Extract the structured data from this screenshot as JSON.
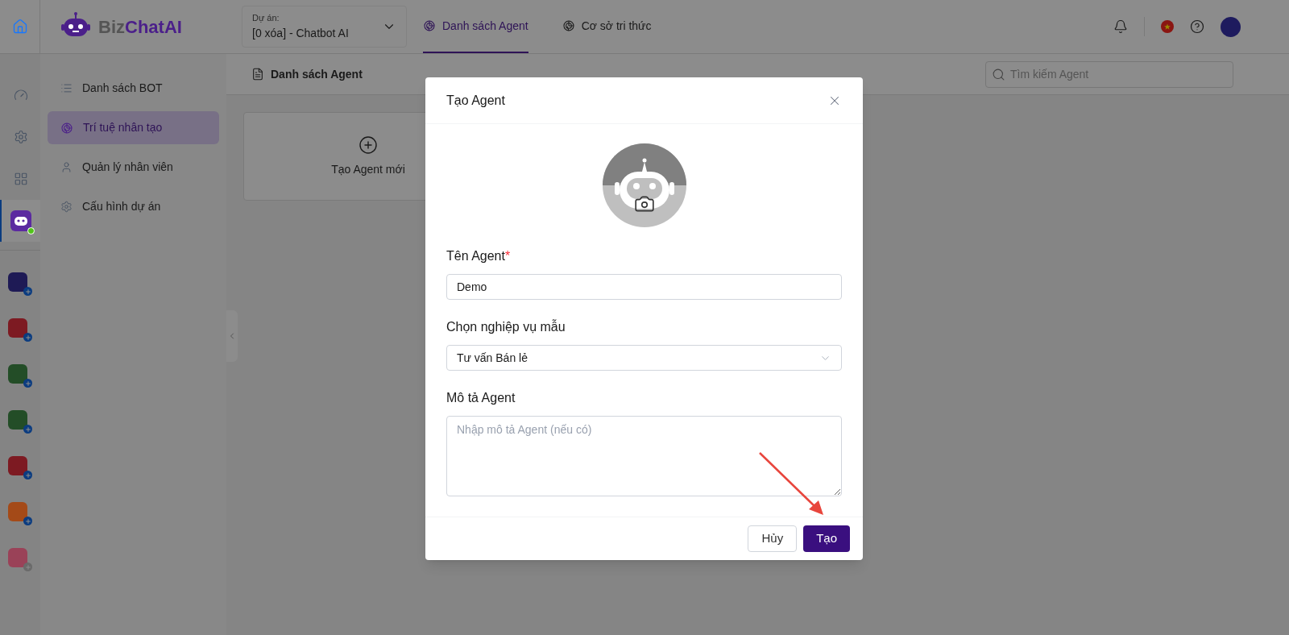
{
  "header": {
    "logo": [
      "Biz",
      "ChatAI"
    ],
    "project": {
      "label": "Dự án:",
      "value": "[0 xóa] - Chatbot AI"
    },
    "tabs": [
      {
        "label": "Danh sách Agent",
        "selected": true
      },
      {
        "label": "Cơ sở tri thức",
        "selected": false
      }
    ]
  },
  "rail": {
    "items": [
      {
        "kind": "dashboard",
        "selected": false
      },
      {
        "kind": "settings",
        "selected": false
      },
      {
        "kind": "grid",
        "selected": false
      },
      {
        "kind": "bot",
        "selected": true
      }
    ],
    "apps": [
      {
        "color": "#1e1a55",
        "disabled": false
      },
      {
        "color": "#7d1a22",
        "disabled": false
      },
      {
        "color": "#234d27",
        "disabled": false
      },
      {
        "color": "#234d27",
        "disabled": false
      },
      {
        "color": "#7d1a22",
        "disabled": false
      },
      {
        "color": "#a44a18",
        "disabled": false
      },
      {
        "color": "#9a4258",
        "disabled": true
      }
    ]
  },
  "sidebar": {
    "items": [
      {
        "kind": "list",
        "label": "Danh sách BOT",
        "selected": false
      },
      {
        "kind": "ai",
        "label": "Trí tuệ nhân tạo",
        "selected": true
      },
      {
        "kind": "user",
        "label": "Quản lý nhân viên",
        "selected": false
      },
      {
        "kind": "settings",
        "label": "Cấu hình dự án",
        "selected": false
      }
    ]
  },
  "content": {
    "title": "Danh sách Agent",
    "search": {
      "placeholder": "Tìm kiếm Agent"
    },
    "new_card": "Tạo Agent mới"
  },
  "modal": {
    "title": "Tạo Agent",
    "name": {
      "label": "Tên Agent",
      "required_mark": "*",
      "value": "Demo"
    },
    "template": {
      "label": "Chọn nghiệp vụ mẫu",
      "value": "Tư vấn Bán lẻ"
    },
    "description": {
      "label": "Mô tả Agent",
      "placeholder": "Nhập mô tả Agent (nếu có)"
    },
    "buttons": [
      {
        "kind": "secondary",
        "label": "Hủy"
      },
      {
        "kind": "primary",
        "label": "Tạo"
      }
    ]
  }
}
